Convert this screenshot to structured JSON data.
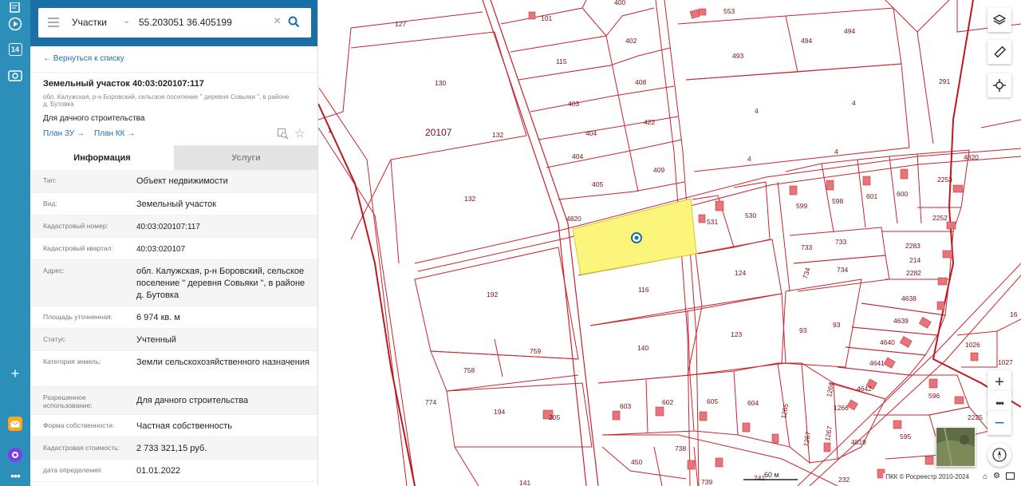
{
  "appbar": {
    "calendar_day": "14"
  },
  "search": {
    "layer": "Участки",
    "query": "55.203051 36.405199"
  },
  "panel": {
    "back": "← Вернуться к списку",
    "title": "Земельный участок 40:03:020107:117",
    "address_small": "обл. Калужская, р-н Боровский, сельское поселение \" деревня Совьяки \", в районе д. Бутовка",
    "purpose": "Для дачного строительства",
    "plan_zu": "План ЗУ →",
    "plan_kk": "План КК →",
    "tabs": [
      "Информация",
      "Услуги"
    ],
    "rows": [
      {
        "k": "Тип:",
        "v": "Объект недвижимости"
      },
      {
        "k": "Вид:",
        "v": "Земельный участок"
      },
      {
        "k": "Кадастровый номер:",
        "v": "40:03:020107:117"
      },
      {
        "k": "Кадастровый квартал:",
        "v": "40:03:020107"
      },
      {
        "k": "Адрес:",
        "v": "обл. Калужская, р-н Боровский, сельское поселение \" деревня Совьяки \", в районе д. Бутовка"
      },
      {
        "k": "Площадь уточненная:",
        "v": "6 974 кв. м"
      },
      {
        "k": "Статус:",
        "v": "Учтенный"
      },
      {
        "k": "Категория земель:",
        "v": "Земли сельскохозяйственного назначения"
      },
      {
        "k": "Разрешенное использование:",
        "v": "Для дачного строительства"
      },
      {
        "k": "Форма собственности:",
        "v": "Частная собственность"
      },
      {
        "k": "Кадастровая стоимость:",
        "v": "2 733 321,15 руб."
      },
      {
        "k": "дата определения:",
        "v": "01.01.2022"
      }
    ]
  },
  "map": {
    "quarter_label": "20107",
    "road_labels": [
      "4820",
      "4820"
    ],
    "parcels": [
      "127",
      "130",
      "132",
      "132",
      "1",
      "101",
      "400",
      "115",
      "402",
      "403",
      "404",
      "404",
      "405",
      "409",
      "408",
      "422",
      "553",
      "493",
      "494",
      "494",
      "4",
      "4",
      "4",
      "4",
      "291",
      "531",
      "530",
      "599",
      "598",
      "601",
      "600",
      "2253",
      "2252",
      "2283",
      "214",
      "2282",
      "733",
      "733",
      "734",
      "734",
      "116",
      "124",
      "192",
      "4638",
      "4639",
      "4640",
      "4641",
      "4642",
      "93",
      "93",
      "123",
      "140",
      "759",
      "758",
      "774",
      "194",
      "205",
      "603",
      "602",
      "605",
      "604",
      "1265",
      "1266",
      "1267",
      "1267",
      "1266",
      "4819",
      "596",
      "2225",
      "595",
      "1026",
      "1027",
      "16",
      "450",
      "738",
      "739",
      "741",
      "232",
      "141"
    ],
    "scale": "60 м",
    "copyright": "ПКК © Росреестр 2010-2024"
  },
  "colors": {
    "accent": "#1a6fa6",
    "parcel_line": "#c8242d",
    "selected_fill": "#fbf67b",
    "appbar": "#2b8fba"
  }
}
